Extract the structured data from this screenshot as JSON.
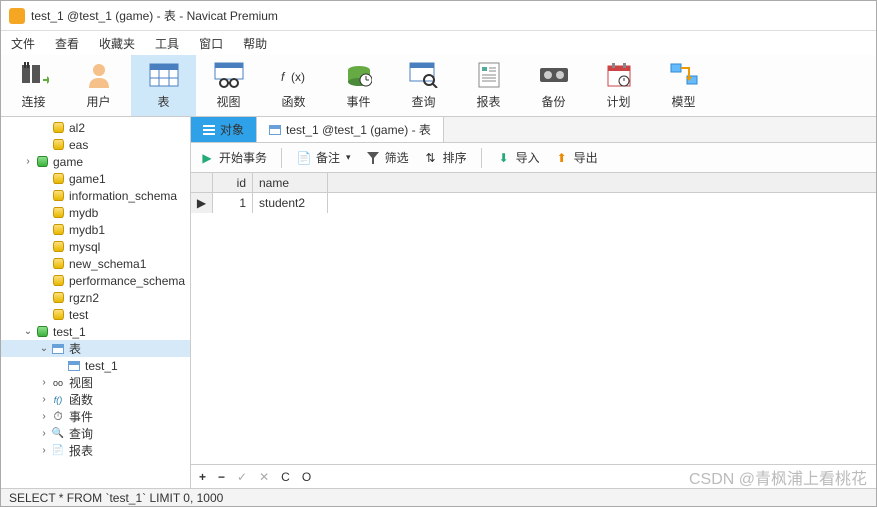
{
  "title": "test_1 @test_1 (game) - 表 - Navicat Premium",
  "menu": [
    "文件",
    "查看",
    "收藏夹",
    "工具",
    "窗口",
    "帮助"
  ],
  "toolbar": [
    {
      "label": "连接"
    },
    {
      "label": "用户"
    },
    {
      "label": "表"
    },
    {
      "label": "视图"
    },
    {
      "label": "函数"
    },
    {
      "label": "事件"
    },
    {
      "label": "查询"
    },
    {
      "label": "报表"
    },
    {
      "label": "备份"
    },
    {
      "label": "计划"
    },
    {
      "label": "模型"
    }
  ],
  "tree": {
    "items": [
      {
        "label": "al2",
        "depth": 2,
        "icon": "cyl"
      },
      {
        "label": "eas",
        "depth": 2,
        "icon": "cyl"
      },
      {
        "label": "game",
        "depth": 1,
        "icon": "cyl-g",
        "exp": "›"
      },
      {
        "label": "game1",
        "depth": 2,
        "icon": "cyl"
      },
      {
        "label": "information_schema",
        "depth": 2,
        "icon": "cyl"
      },
      {
        "label": "mydb",
        "depth": 2,
        "icon": "cyl"
      },
      {
        "label": "mydb1",
        "depth": 2,
        "icon": "cyl"
      },
      {
        "label": "mysql",
        "depth": 2,
        "icon": "cyl"
      },
      {
        "label": "new_schema1",
        "depth": 2,
        "icon": "cyl"
      },
      {
        "label": "performance_schema",
        "depth": 2,
        "icon": "cyl"
      },
      {
        "label": "rgzn2",
        "depth": 2,
        "icon": "cyl"
      },
      {
        "label": "test",
        "depth": 2,
        "icon": "cyl"
      },
      {
        "label": "test_1",
        "depth": 1,
        "icon": "cyl-g",
        "exp": "⌄"
      },
      {
        "label": "表",
        "depth": 2,
        "icon": "tbl",
        "exp": "⌄",
        "sel": true
      },
      {
        "label": "test_1",
        "depth": 3,
        "icon": "tbl"
      },
      {
        "label": "视图",
        "depth": 2,
        "icon": "view",
        "exp": "›",
        "pre": "oo"
      },
      {
        "label": "函数",
        "depth": 2,
        "icon": "fn",
        "exp": "›",
        "pre": "f()"
      },
      {
        "label": "事件",
        "depth": 2,
        "icon": "ev",
        "exp": "›"
      },
      {
        "label": "查询",
        "depth": 2,
        "icon": "qry",
        "exp": "›"
      },
      {
        "label": "报表",
        "depth": 2,
        "icon": "rpt",
        "exp": "›"
      }
    ]
  },
  "tabs": {
    "obj": "对象",
    "data": "test_1 @test_1 (game) - 表"
  },
  "filterbar": {
    "begin": "开始事务",
    "memo": "备注",
    "filter": "筛选",
    "sort": "排序",
    "import": "导入",
    "export": "导出"
  },
  "grid": {
    "cols": [
      "id",
      "name"
    ],
    "rows": [
      {
        "id": "1",
        "name": "student2"
      }
    ]
  },
  "navbar": {
    "symbols": [
      "+",
      "−",
      "✓",
      "✕",
      "C",
      "O"
    ]
  },
  "status": "SELECT * FROM `test_1` LIMIT 0, 1000",
  "watermark": "CSDN @青枫浦上看桃花"
}
